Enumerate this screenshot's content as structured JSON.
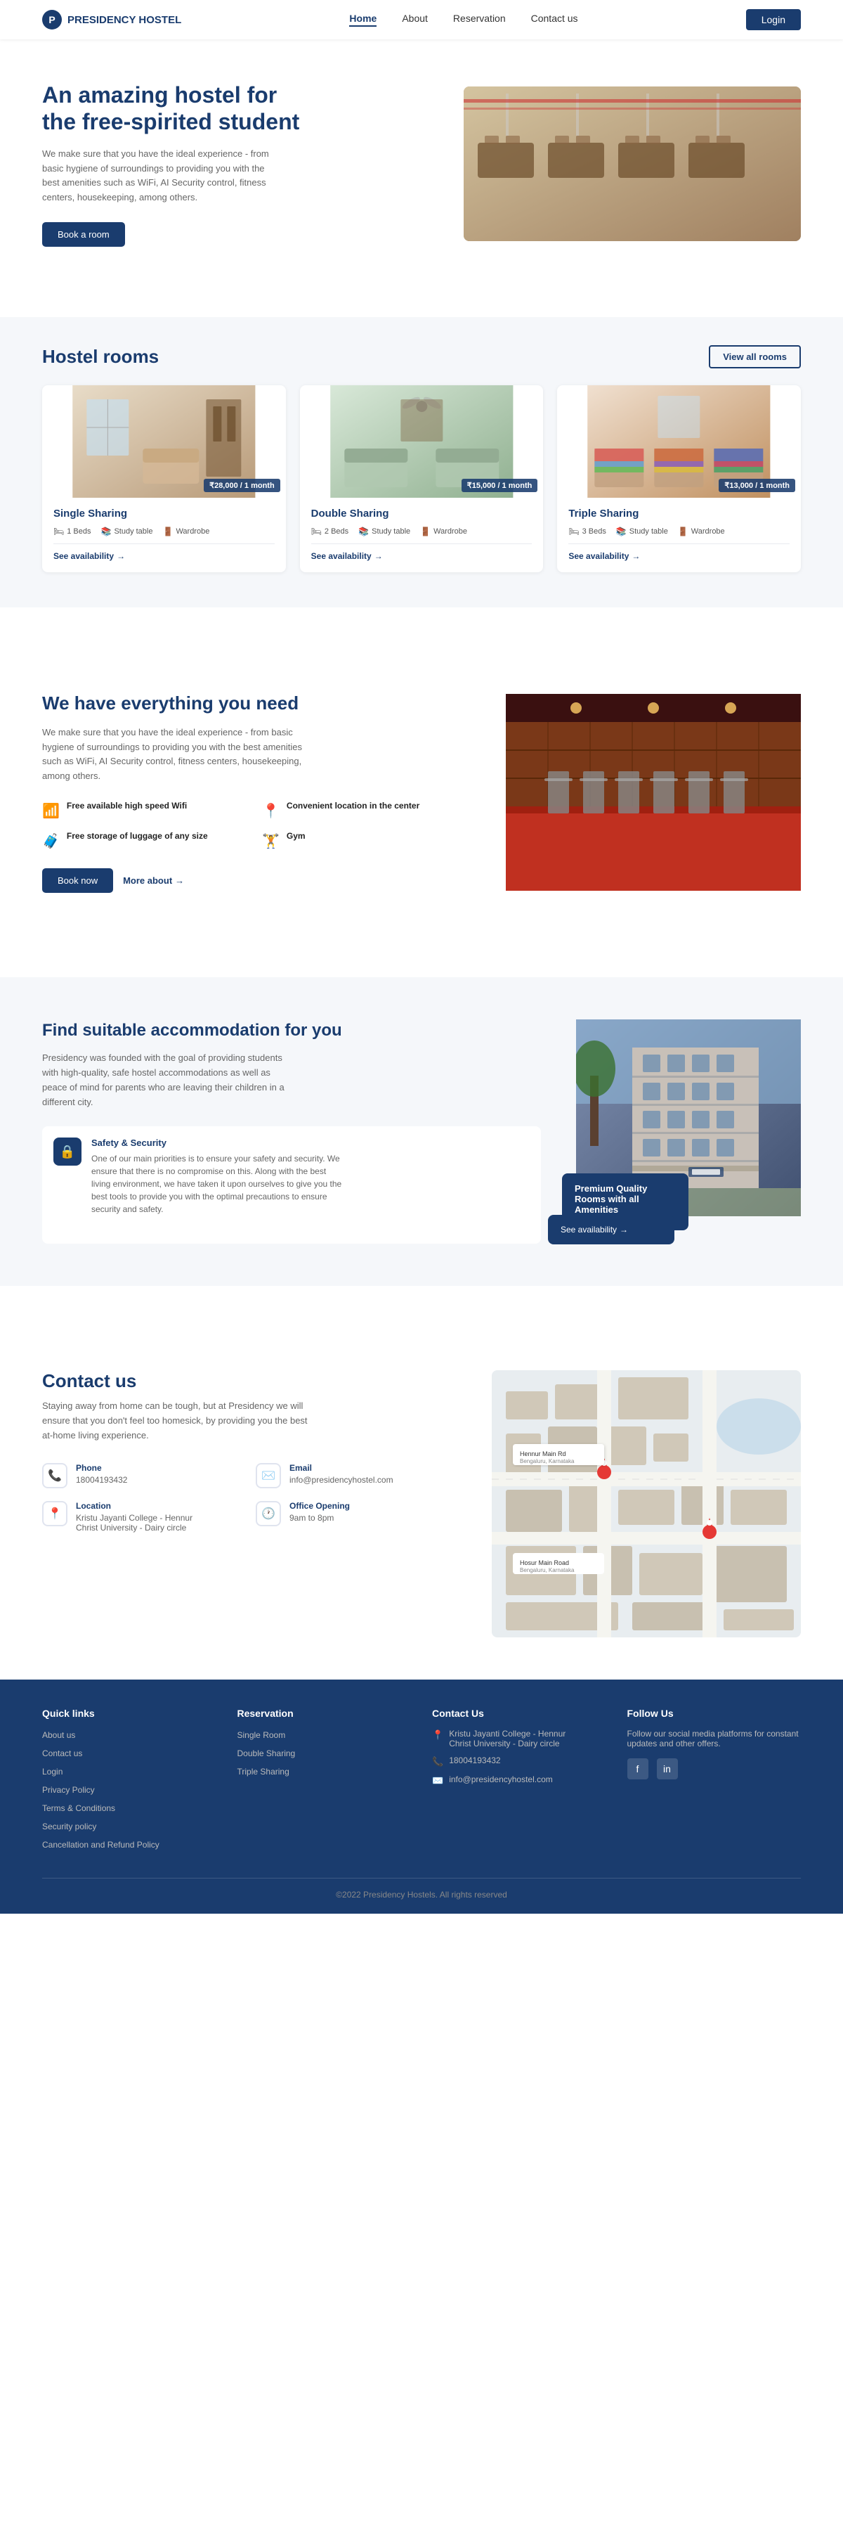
{
  "brand": {
    "name": "PRESIDENCY HOSTEL",
    "logo_letter": "P"
  },
  "nav": {
    "links": [
      {
        "label": "Home",
        "active": true
      },
      {
        "label": "About",
        "active": false
      },
      {
        "label": "Reservation",
        "active": false
      },
      {
        "label": "Contact us",
        "active": false
      }
    ],
    "login_label": "Login"
  },
  "hero": {
    "heading_line1": "An amazing hostel for",
    "heading_line2": "the free-spirited student",
    "description": "We make sure that you have the ideal experience - from basic hygiene of surroundings to providing you with the best amenities such as WiFi, AI Security control, fitness centers, housekeeping, among others.",
    "cta_label": "Book a room"
  },
  "rooms": {
    "section_title": "Hostel rooms",
    "view_all_label": "View all rooms",
    "cards": [
      {
        "title": "Single Sharing",
        "price": "₹28,000 / 1 month",
        "amenities": [
          "1 Beds",
          "Study table",
          "Wardrobe"
        ],
        "see_label": "See availability"
      },
      {
        "title": "Double Sharing",
        "price": "₹15,000 / 1 month",
        "amenities": [
          "2 Beds",
          "Study table",
          "Wardrobe"
        ],
        "see_label": "See availability"
      },
      {
        "title": "Triple Sharing",
        "price": "₹13,000 / 1 month",
        "amenities": [
          "3 Beds",
          "Study table",
          "Wardrobe"
        ],
        "see_label": "See availability"
      }
    ]
  },
  "features": {
    "heading": "We have everything you need",
    "description": "We make sure that you have the ideal experience - from basic hygiene of surroundings to providing you with the best amenities such as WiFi, AI Security control, fitness centers, housekeeping, among others.",
    "items": [
      {
        "icon": "📶",
        "title": "Free available high speed Wifi"
      },
      {
        "icon": "📍",
        "title": "Convenient location in the center"
      },
      {
        "icon": "🧳",
        "title": "Free storage of luggage of any size"
      },
      {
        "icon": "🏋️",
        "title": "Gym"
      }
    ],
    "book_label": "Book now",
    "more_label": "More about"
  },
  "accommodation": {
    "heading": "Find suitable accommodation for you",
    "description": "Presidency was founded with the goal of providing students with high-quality, safe hostel accommodations as well as peace of mind for parents who are leaving their children in a different city.",
    "safety": {
      "title": "Safety & Security",
      "description": "One of our main priorities is to ensure your safety and security. We ensure that there is no compromise on this. Along with the best living environment, we have taken it upon ourselves to give you the best tools to provide you with the optimal precautions to ensure security and safety."
    },
    "overlay_card": {
      "title": "Premium Quality Rooms with all Amenities",
      "see_label": "See availability"
    }
  },
  "contact": {
    "section_title": "Contact us",
    "description": "Staying away from home can be tough, but at Presidency we will ensure that you don't feel too homesick, by providing you the best at-home living experience.",
    "items": [
      {
        "icon": "📞",
        "label": "Phone",
        "value": "18004193432"
      },
      {
        "icon": "✉️",
        "label": "Email",
        "value": "info@presidencyhostel.com"
      },
      {
        "icon": "📍",
        "label": "Location",
        "value": "Kristu Jayanti College - Hennur\nChrist University - Dairy circle"
      },
      {
        "icon": "🕐",
        "label": "Office Opening",
        "value": "9am to 8pm"
      }
    ]
  },
  "footer": {
    "quick_links": {
      "title": "Quick links",
      "items": [
        "About us",
        "Contact us",
        "Login",
        "Privacy Policy",
        "Terms & Conditions",
        "Security policy",
        "Cancellation and Refund Policy"
      ]
    },
    "reservation": {
      "title": "Reservation",
      "items": [
        "Single Room",
        "Double Sharing",
        "Triple Sharing"
      ]
    },
    "contact_us": {
      "title": "Contact Us",
      "items": [
        {
          "icon": "📍",
          "text": "Kristu Jayanti College - Hennur\nChrist University - Dairy circle"
        },
        {
          "icon": "📞",
          "text": "18004193432"
        },
        {
          "icon": "✉️",
          "text": "info@presidencyhostel.com"
        }
      ]
    },
    "follow_us": {
      "title": "Follow Us",
      "description": "Follow our social media platforms for constant updates and other offers.",
      "social": [
        "f",
        "in"
      ]
    },
    "copyright": "©2022 Presidency Hostels. All rights reserved"
  }
}
